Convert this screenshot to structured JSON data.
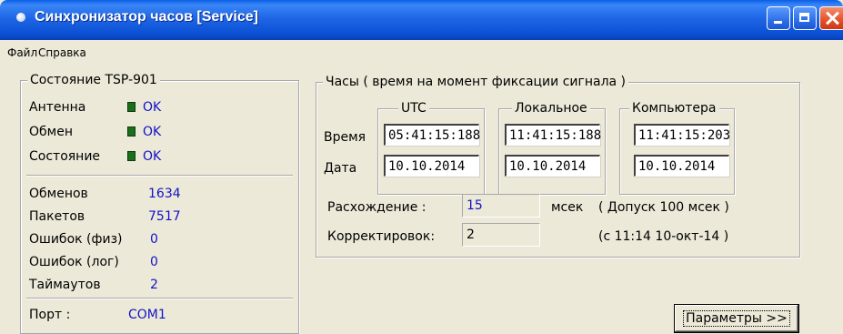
{
  "window": {
    "title": "Синхронизатор часов [Service]",
    "accent_color": "#0a5fe6",
    "buttons": [
      "minimize-icon",
      "maximize-icon",
      "close-icon"
    ]
  },
  "menu": {
    "file": "Файл",
    "help": "Справка"
  },
  "status": {
    "title": "Состояние TSP-901",
    "antenna": {
      "label": "Антенна",
      "value": "OK"
    },
    "exchange": {
      "label": "Обмен",
      "value": "OK"
    },
    "state": {
      "label": "Состояние",
      "value": "OK"
    },
    "led_color": "#1b6e1b",
    "counters": {
      "exchanges": {
        "label": "Обменов",
        "value": "1634"
      },
      "packets": {
        "label": "Пакетов",
        "value": "7517"
      },
      "phys_errors": {
        "label": "Ошибок (физ)",
        "value": "0"
      },
      "log_errors": {
        "label": "Ошибок (лог)",
        "value": "0"
      },
      "timeouts": {
        "label": "Таймаутов",
        "value": "2"
      }
    },
    "port": {
      "label": "Порт :",
      "value": "COM1"
    }
  },
  "clocks": {
    "title": "Часы ( время на момент фиксации сигнала )",
    "time_label": "Время",
    "date_label": "Дата",
    "utc": {
      "title": "UTC",
      "time": "05:41:15:188",
      "date": "10.10.2014"
    },
    "local": {
      "title": "Локальное",
      "time": "11:41:15:188",
      "date": "10.10.2014"
    },
    "computer": {
      "title": "Компьютера",
      "time": "11:41:15:203",
      "date": "10.10.2014"
    },
    "discrepancy": {
      "label": "Расхождение :",
      "value": "15",
      "unit": "мсек",
      "tolerance": "( Допуск 100 мсек )"
    },
    "corrections": {
      "label": "Корректировок:",
      "value": "2",
      "since": "(с 11:14 10-окт-14 )"
    }
  },
  "params_button": "Параметры >>"
}
